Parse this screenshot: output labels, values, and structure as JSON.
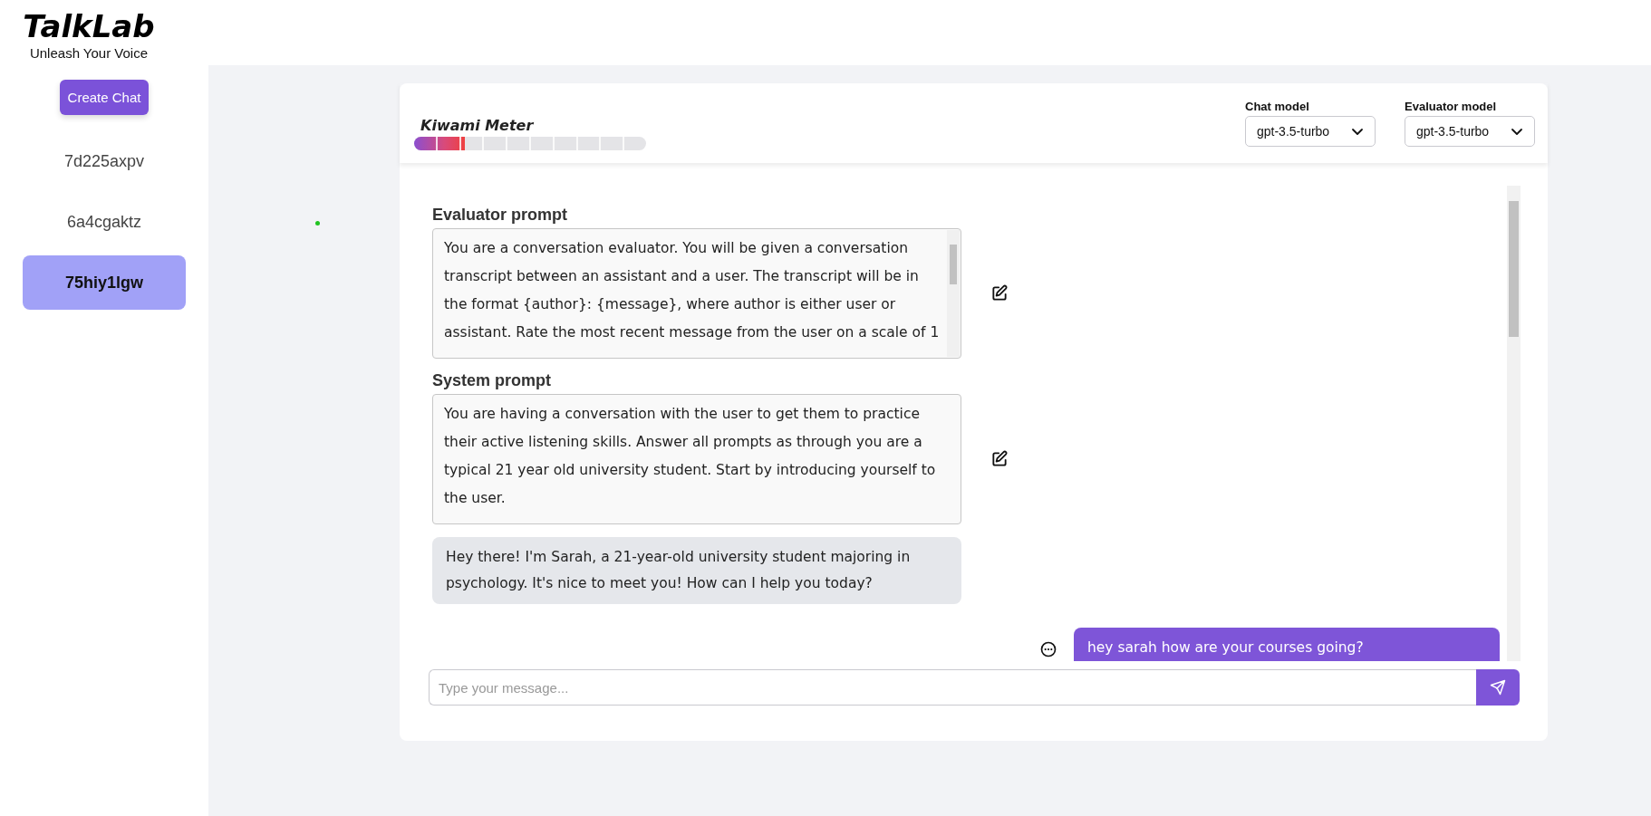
{
  "brand": {
    "title": "TalkLab",
    "tagline": "Unleash Your Voice"
  },
  "sidebar": {
    "create_button": "Create Chat",
    "items": [
      {
        "label": "7d225axpv",
        "selected": false
      },
      {
        "label": "6a4cgaktz",
        "selected": false
      },
      {
        "label": "75hiy1lgw",
        "selected": true
      }
    ]
  },
  "meter": {
    "title": "Kiwami Meter",
    "level": 0.22
  },
  "selects": [
    {
      "label": "Chat model",
      "value": "gpt-3.5-turbo"
    },
    {
      "label": "Evaluator model",
      "value": "gpt-3.5-turbo"
    }
  ],
  "prompts": [
    {
      "label": "Evaluator prompt",
      "text": "You are a conversation evaluator. You will be given a conversation transcript between an assistant and a user. The transcript will be in the format {author}: {message}, where author is either user or assistant. Rate the most recent message from the user on a scale of 1"
    },
    {
      "label": "System prompt",
      "text": "You are having a conversation with the user to get them to practice their active listening skills. Answer all prompts as through you are a typical 21 year old university student. Start by introducing yourself to the user."
    }
  ],
  "messages": [
    {
      "kind": "incoming",
      "text": "Hey there! I'm Sarah, a 21-year-old university student majoring in psychology. It's nice to meet you! How can I help you today?"
    },
    {
      "kind": "outgoing",
      "text": "hey sarah how are your courses going?"
    }
  ],
  "composer": {
    "placeholder": "Type your message..."
  }
}
